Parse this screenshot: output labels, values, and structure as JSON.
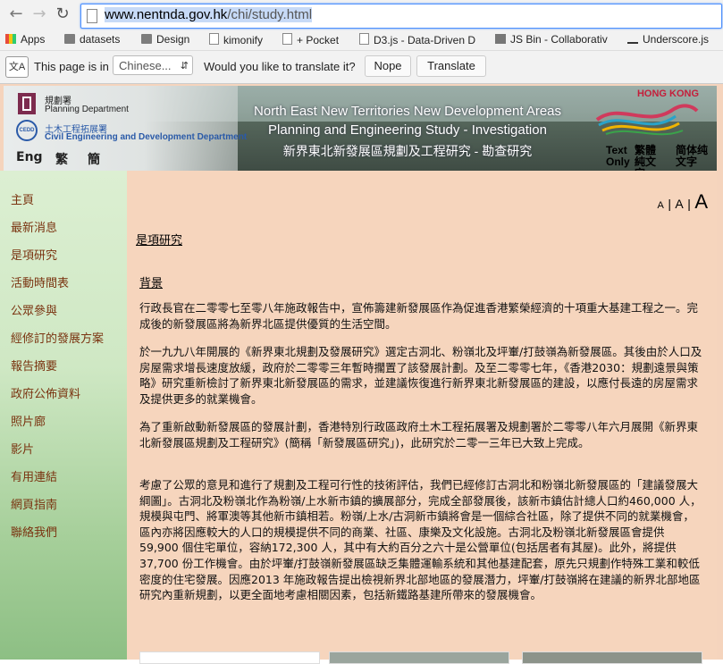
{
  "browser": {
    "url_domain": "www.nentnda.gov.hk",
    "url_path": "/chi/study.html",
    "bookmarks": [
      {
        "label": "Apps",
        "icon": "apps-grid-icon"
      },
      {
        "label": "datasets",
        "icon": "folder-icon"
      },
      {
        "label": "Design",
        "icon": "folder-icon"
      },
      {
        "label": "kimonify",
        "icon": "page-icon"
      },
      {
        "label": "+ Pocket",
        "icon": "page-icon"
      },
      {
        "label": "D3.js - Data-Driven D",
        "icon": "page-icon"
      },
      {
        "label": "JS Bin - Collaborativ",
        "icon": "jsbin-icon"
      },
      {
        "label": "Underscore.js",
        "icon": "underscore-icon"
      }
    ],
    "translate": {
      "prefix": "This page is in",
      "language": "Chinese...",
      "question": "Would you like to translate it?",
      "nope": "Nope",
      "translate": "Translate"
    }
  },
  "banner": {
    "planning_dept_zh": "規劃署",
    "planning_dept_en": "Planning Department",
    "cedd_zh": "土木工程拓展署",
    "cedd_en": "Civil Engineering and Development Department",
    "cedd_mark": "CEDD",
    "lang_eng": "Eng",
    "lang_trad": "繁",
    "lang_simp": "簡",
    "title_line1": "North East New Territories New Development Areas",
    "title_line2": "Planning and Engineering Study - Investigation",
    "title_zh": "新界東北新發展區規劃及工程研究 - 勘查研究",
    "hk_brand": "HONG KONG",
    "textonly_en": "Text Only",
    "textonly_trad": "繁體純文字",
    "textonly_simp": "简体纯文字"
  },
  "sidebar": {
    "items": [
      "主頁",
      "最新消息",
      "是項研究",
      "活動時間表",
      "公眾參與",
      "經修訂的發展方案",
      "報告摘要",
      "政府公佈資料",
      "照片廊",
      "影片",
      "有用連結",
      "網頁指南",
      "聯絡我們"
    ]
  },
  "main": {
    "font_small": "A",
    "font_medium": "A",
    "font_large": "A",
    "sep": "|",
    "heading": "是項研究",
    "subheading": "背景",
    "paragraphs": [
      "行政長官在二零零七至零八年施政報告中，宣佈籌建新發展區作為促進香港繁榮經濟的十項重大基建工程之一。完成後的新發展區將為新界北區提供優質的生活空間。",
      "於一九九八年開展的《新界東北規劃及發展研究》選定古洞北、粉嶺北及坪輋/打鼓嶺為新發展區。其後由於人口及房屋需求增長速度放緩，政府於二零零三年暫時擱置了該發展計劃。及至二零零七年，《香港2030：規劃遠景與策略》研究重新檢討了新界東北新發展區的需求，並建議恢復進行新界東北新發展區的建設，以應付長遠的房屋需求及提供更多的就業機會。",
      "為了重新啟動新發展區的發展計劃，香港特別行政區政府土木工程拓展署及規劃署於二零零八年六月展開《新界東北新發展區規劃及工程研究》(簡稱「新發展區研究」)，此研究於二零一三年已大致上完成。",
      "考慮了公眾的意見和進行了規劃及工程可行性的技術評估，我們已經修訂古洞北和粉嶺北新發展區的「建議發展大綱圖」。古洞北及粉嶺北作為粉嶺/上水新市鎮的擴展部分，完成全部發展後，該新市鎮估計總人口約460,000 人，規模與屯門、將軍澳等其他新市鎮相若。粉嶺/上水/古洞新市鎮將會是一個綜合社區，除了提供不同的就業機會，區內亦將因應較大的人口的規模提供不同的商業、社區、康樂及文化設施。古洞北及粉嶺北新發展區會提供59,900 個住宅單位，容納172,300 人，其中有大約百分之六十是公營單位(包括居者有其屋)。此外，將提供37,700 份工作機會。由於坪輋/打鼓嶺新發展區缺乏集體運輸系統和其他基建配套，原先只規劃作特殊工業和較低密度的住宅發展。因應2013 年施政報告提出檢視新界北部地區的發展潛力，坪輋/打鼓嶺將在建議的新界北部地區研究內重新規劃，以更全面地考慮相關因素，包括新鐵路基建所帶來的發展機會。"
    ]
  }
}
